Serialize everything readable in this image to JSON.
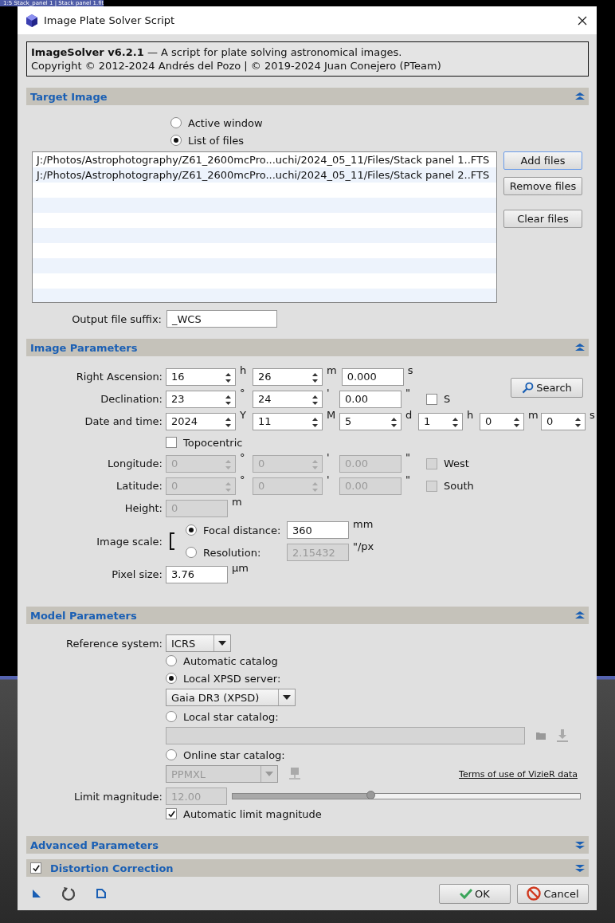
{
  "background_window": {
    "title": "1:5 Stack_panel 1 | Stack panel 1.fit"
  },
  "window": {
    "title": "Image Plate Solver Script"
  },
  "header": {
    "description": "**ImageSolver v6.2.1** — A script for plate solving astronomical images.",
    "copyright": "Copyright © 2012-2024 Andrés del Pozo | © 2019-2024 Juan Conejero (PTeam)"
  },
  "target_image": {
    "title": "Target Image",
    "expanded": true,
    "sources": [
      {
        "label": "Active window",
        "selected": false
      },
      {
        "label": "List of files",
        "selected": true
      }
    ],
    "files": [
      "J:/Photos/Astrophotography/Z61_2600mcPro...uchi/2024_05_11/Files/Stack panel 1..FTS",
      "J:/Photos/Astrophotography/Z61_2600mcPro...uchi/2024_05_11/Files/Stack panel 2..FTS"
    ],
    "buttons": [
      {
        "label": "Add files",
        "focused": true
      },
      {
        "label": "Remove files",
        "focused": false
      },
      {
        "label": "Clear files",
        "focused": false
      }
    ],
    "output_suffix": {
      "label": "Output file suffix:",
      "value": "_WCS"
    }
  },
  "image_parameters": {
    "title": "Image Parameters",
    "expanded": true,
    "search_button": "Search",
    "coordinate_rows": [
      {
        "label": "Right Ascension:",
        "disabled": false,
        "fields": [
          {
            "kind": "spin",
            "value": "16",
            "unit": "h"
          },
          {
            "kind": "spin",
            "value": "26",
            "unit": "m"
          },
          {
            "kind": "text",
            "value": "0.000",
            "unit": "s"
          }
        ]
      },
      {
        "label": "Declination:",
        "disabled": false,
        "fields": [
          {
            "kind": "spin",
            "value": "23",
            "unit": "°"
          },
          {
            "kind": "spin",
            "value": "24",
            "unit": "'"
          },
          {
            "kind": "text",
            "value": "0.00",
            "unit": "\""
          }
        ],
        "checkbox": {
          "label": "S",
          "checked": false
        }
      },
      {
        "label": "Date and time:",
        "disabled": false,
        "fields": [
          {
            "kind": "spin",
            "value": "2024",
            "unit": "Y"
          },
          {
            "kind": "spin",
            "value": "11",
            "unit": "M"
          },
          {
            "kind": "spin",
            "value": "5",
            "unit": "d"
          },
          {
            "kind": "spin",
            "value": "1",
            "unit": "h"
          },
          {
            "kind": "spin",
            "value": "0",
            "unit": "m"
          },
          {
            "kind": "spin",
            "value": "0",
            "unit": "s"
          }
        ]
      }
    ],
    "topocentric": {
      "label": "Topocentric",
      "checked": false
    },
    "location_rows": [
      {
        "label": "Longitude:",
        "disabled": true,
        "fields": [
          {
            "kind": "spin",
            "value": "0",
            "unit": "°"
          },
          {
            "kind": "spin",
            "value": "0",
            "unit": "'"
          },
          {
            "kind": "text",
            "value": "0.00",
            "unit": "\""
          }
        ],
        "checkbox": {
          "label": "West",
          "checked": false
        }
      },
      {
        "label": "Latitude:",
        "disabled": true,
        "fields": [
          {
            "kind": "spin",
            "value": "0",
            "unit": "°"
          },
          {
            "kind": "spin",
            "value": "0",
            "unit": "'"
          },
          {
            "kind": "text",
            "value": "0.00",
            "unit": "\""
          }
        ],
        "checkbox": {
          "label": "South",
          "checked": false
        }
      }
    ],
    "height": {
      "label": "Height:",
      "value": "0",
      "unit": "m",
      "disabled": true
    },
    "image_scale": {
      "label": "Image scale:",
      "options": [
        {
          "label": "Focal distance:",
          "selected": true,
          "value": "360",
          "unit": "mm"
        },
        {
          "label": "Resolution:",
          "selected": false,
          "value": "2.15432",
          "unit": "\"/px"
        }
      ]
    },
    "pixel_size": {
      "label": "Pixel size:",
      "value": "3.76",
      "unit": "µm"
    }
  },
  "model_parameters": {
    "title": "Model Parameters",
    "expanded": true,
    "reference_system": {
      "label": "Reference system:",
      "value": "ICRS"
    },
    "catalogs": [
      {
        "kind": "auto",
        "label": "Automatic catalog",
        "selected": false
      },
      {
        "kind": "xpsd",
        "label": "Local XPSD server:",
        "selected": true,
        "dropdown": "Gaia DR3 (XPSD)"
      },
      {
        "kind": "local",
        "label": "Local star catalog:",
        "selected": false
      },
      {
        "kind": "online",
        "label": "Online star catalog:",
        "selected": false,
        "dropdown": "PPMXL",
        "link": "Terms of use of VizieR data"
      }
    ],
    "limit_magnitude": {
      "label": "Limit magnitude:",
      "value": "12.00",
      "disabled": true,
      "level": 0.4
    },
    "auto_limit": {
      "label": "Automatic limit magnitude",
      "checked": true
    }
  },
  "collapsed_sections": [
    {
      "kind": "plain",
      "title": "Advanced Parameters",
      "expanded": false
    },
    {
      "kind": "checkable",
      "title": "Distortion Correction",
      "expanded": false,
      "checked": true
    }
  ],
  "buttons": [
    {
      "kind": "ok",
      "label": "OK"
    },
    {
      "kind": "cancel",
      "label": "Cancel"
    }
  ]
}
